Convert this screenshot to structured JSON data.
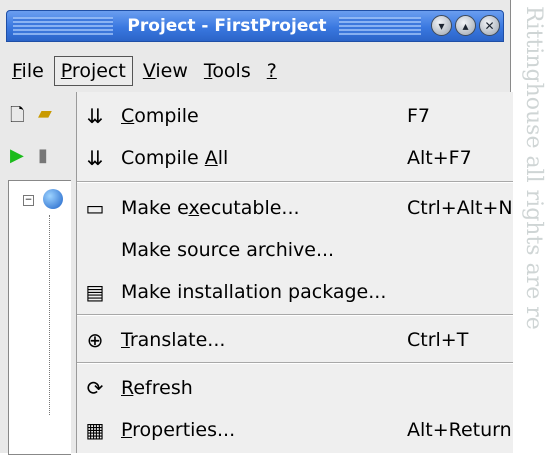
{
  "window": {
    "title": "Project - FirstProject",
    "controls": [
      "minimize",
      "maximize",
      "close"
    ]
  },
  "menubar": {
    "items": [
      {
        "label": "File",
        "mnemonic": "F"
      },
      {
        "label": "Project",
        "mnemonic": "P"
      },
      {
        "label": "View",
        "mnemonic": "V"
      },
      {
        "label": "Tools",
        "mnemonic": "T"
      },
      {
        "label": "?",
        "mnemonic": "?"
      }
    ]
  },
  "dropdown": {
    "items": [
      {
        "label": "Compile",
        "shortcut": "F7",
        "icon": "compile-icon"
      },
      {
        "label": "Compile All",
        "shortcut": "Alt+F7",
        "icon": "compile-all-icon"
      },
      {
        "label": "Make executable...",
        "shortcut": "Ctrl+Alt+N",
        "icon": "window-icon"
      },
      {
        "label": "Make source archive...",
        "shortcut": "",
        "icon": ""
      },
      {
        "label": "Make installation package...",
        "shortcut": "",
        "icon": "package-icon"
      },
      {
        "label": "Translate...",
        "shortcut": "Ctrl+T",
        "icon": "translate-icon"
      },
      {
        "label": "Refresh",
        "shortcut": "",
        "icon": "refresh-icon"
      },
      {
        "label": "Properties...",
        "shortcut": "Alt+Return",
        "icon": "properties-icon"
      }
    ]
  },
  "watermark": "Rittinghouse all rights are re"
}
